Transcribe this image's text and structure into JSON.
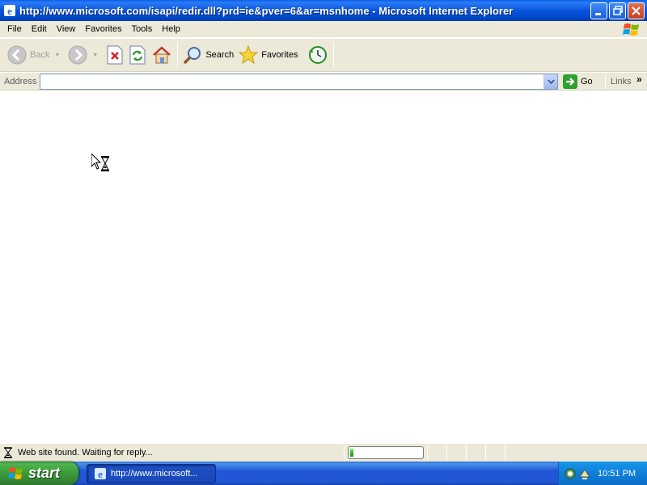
{
  "window": {
    "title": "http://www.microsoft.com/isapi/redir.dll?prd=ie&pver=6&ar=msnhome - Microsoft Internet Explorer"
  },
  "menu": {
    "items": [
      "File",
      "Edit",
      "View",
      "Favorites",
      "Tools",
      "Help"
    ]
  },
  "toolbar": {
    "back_label": "Back",
    "search_label": "Search",
    "favorites_label": "Favorites"
  },
  "address": {
    "label": "Address",
    "value": "",
    "go_label": "Go",
    "links_label": "Links",
    "links_chevron": "»"
  },
  "status": {
    "text": "Web site found. Waiting for reply...",
    "progress": 0.05
  },
  "taskbar": {
    "start_label": "start",
    "task_label": "http://www.microsoft...",
    "clock": "10:51 PM"
  },
  "icons": {
    "back": "back-arrow-icon",
    "forward": "forward-arrow-icon",
    "stop": "stop-icon",
    "refresh": "refresh-icon",
    "home": "home-icon",
    "search": "search-icon",
    "favorites": "star-icon",
    "history": "history-icon",
    "busy_cursor": "hourglass-cursor-icon"
  },
  "colors": {
    "titlebar": "#0954dc",
    "chrome": "#ece9d8",
    "start_green": "#3b9a3b",
    "taskbar_blue": "#2157d7",
    "progress_green": "#2fb82f"
  }
}
